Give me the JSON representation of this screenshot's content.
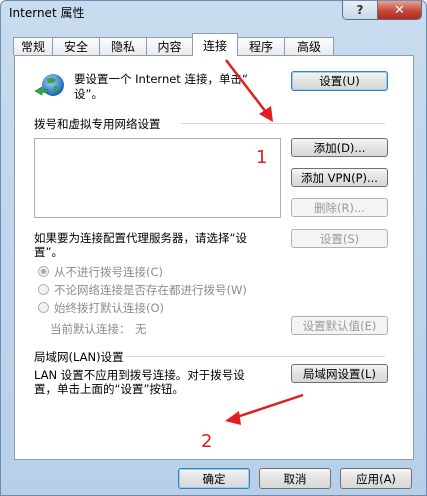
{
  "window": {
    "title": "Internet 属性",
    "help_label": "?",
    "close_label": "✕"
  },
  "tabs": [
    "常规",
    "安全",
    "隐私",
    "内容",
    "连接",
    "程序",
    "高级"
  ],
  "active_tab": "连接",
  "setup": {
    "text_line1": "要设置一个 Internet 连接，单击“",
    "text_line2": "设”。",
    "button": "设置(U)"
  },
  "dialup": {
    "header": "拨号和虚拟专用网络设置",
    "add_button": "添加(D)...",
    "add_vpn_button": "添加 VPN(P)...",
    "delete_button": "删除(R)...",
    "settings_button": "设置(S)",
    "proxy_text_line1": "如果要为连接配置代理服务器，请选择“设",
    "proxy_text_line2": "置”。",
    "options": [
      "从不进行拨号连接(C)",
      "不论网络连接是否存在都进行拨号(W)",
      "始终拨打默认连接(O)"
    ],
    "current_default_label": "当前默认连接：",
    "current_default_value": "无",
    "set_default_button": "设置默认值(E)"
  },
  "lan": {
    "header": "局域网(LAN)设置",
    "text_line1": "LAN 设置不应用到拨号连接。对于拨号设",
    "text_line2": "置，单击上面的“设置”按钮。",
    "button": "局域网设置(L)"
  },
  "footer": {
    "ok": "确定",
    "cancel": "取消",
    "apply": "应用(A)"
  },
  "annotations": {
    "one": "1",
    "two": "2"
  },
  "colors": {
    "annotation": "#e02020",
    "title_bar": "#c9dcef"
  }
}
